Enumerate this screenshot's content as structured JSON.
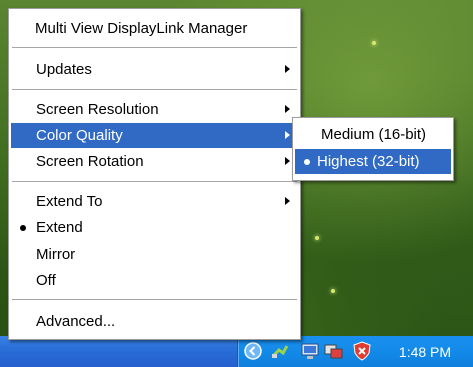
{
  "main_menu": {
    "title": "Multi View DisplayLink Manager",
    "updates": "Updates",
    "screen_resolution": "Screen Resolution",
    "color_quality": "Color Quality",
    "screen_rotation": "Screen Rotation",
    "extend_to": "Extend To",
    "extend": "Extend",
    "mirror": "Mirror",
    "off": "Off",
    "advanced": "Advanced..."
  },
  "color_quality_submenu": {
    "medium": "Medium (16-bit)",
    "highest": "Highest (32-bit)"
  },
  "taskbar": {
    "clock": "1:48 PM",
    "tray_icons": [
      "show-hidden-icons-arrow-icon",
      "network-icon",
      "monitor-icon",
      "displaylink-icon",
      "security-shield-icon"
    ]
  },
  "colors": {
    "menu_highlight": "#316ac5",
    "taskbar_blue": "#245fcd",
    "tray_blue": "#138ae8"
  }
}
